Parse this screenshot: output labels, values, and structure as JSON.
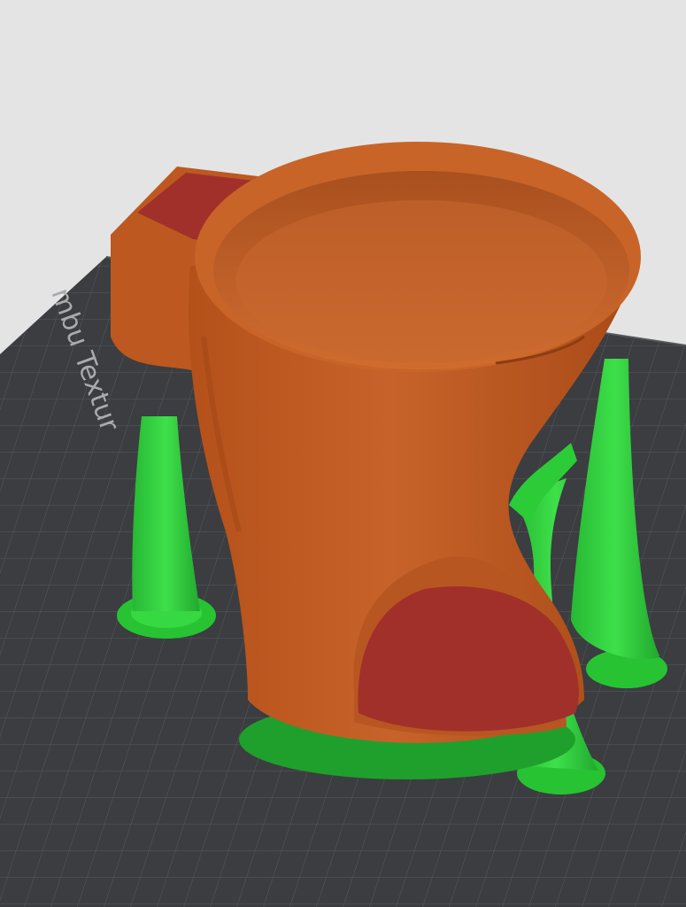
{
  "viewport": {
    "background_color": "#e4e4e4"
  },
  "build_plate": {
    "label_text": "mbu Textur",
    "plate_color": "#3b3d40",
    "grid_color": "#5b5d60",
    "label_color": "#a9abad"
  },
  "model": {
    "body_color": "#bf5a21",
    "body_shadow_color": "#9b4416",
    "body_highlight_color": "#d2702f",
    "overhang_color": "#a1302a"
  },
  "supports": {
    "color": "#2fd43c",
    "dark_color": "#1f9d2c",
    "count": 4
  }
}
